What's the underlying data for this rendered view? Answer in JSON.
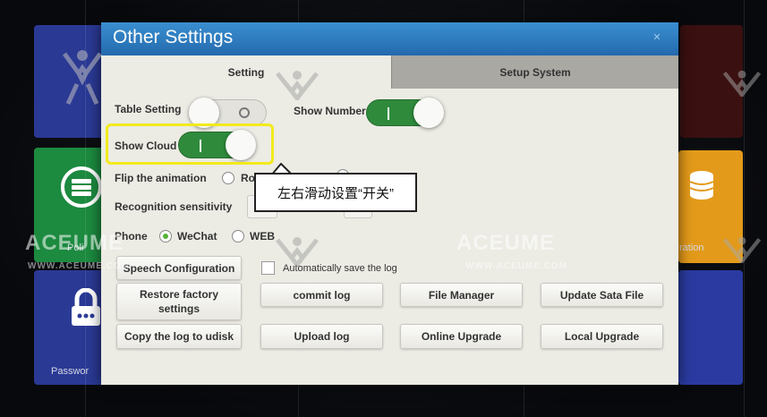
{
  "dialog": {
    "title": "Other Settings",
    "close_glyph": "✕"
  },
  "tabs": [
    {
      "label": "Setting"
    },
    {
      "label": "Setup System"
    }
  ],
  "settings": {
    "table_setting_label": "Table Setting",
    "show_number_label": "Show Number",
    "show_cloud_label": "Show Cloud",
    "flip_animation_label": "Flip the animation",
    "flip_option_1": "Ro",
    "recognition_label": "Recognition sensitivity",
    "phone_label": "Phone",
    "phone_options": [
      "WeChat",
      "WEB"
    ],
    "phone_selected": "WeChat",
    "table_setting_on": false,
    "show_number_on": true,
    "show_cloud_on": true
  },
  "callout": {
    "text": "左右滑动设置“开关”"
  },
  "buttons": {
    "speech_configuration": "Speech Configuration",
    "auto_save_log": "Automatically save the log",
    "restore_factory_line1": "Restore factory",
    "restore_factory_line2": "settings",
    "commit_log": "commit log",
    "file_manager": "File Manager",
    "update_sata_file": "Update Sata File",
    "copy_log_to_udisk": "Copy the log to udisk",
    "upload_log": "Upload log",
    "online_upgrade": "Online Upgrade",
    "local_upgrade": "Local Upgrade"
  },
  "background": {
    "tile_labels": [
      "Poli",
      "Passwor",
      "ration"
    ]
  },
  "watermark": {
    "brand": "ACEUME",
    "url": "WWW.ACEUME.COM"
  },
  "colors": {
    "title_bar": "#2f7fc2",
    "toggle_on": "#2f8a3c",
    "highlight": "#f2ea1c",
    "radio_checked": "#57b33a"
  }
}
